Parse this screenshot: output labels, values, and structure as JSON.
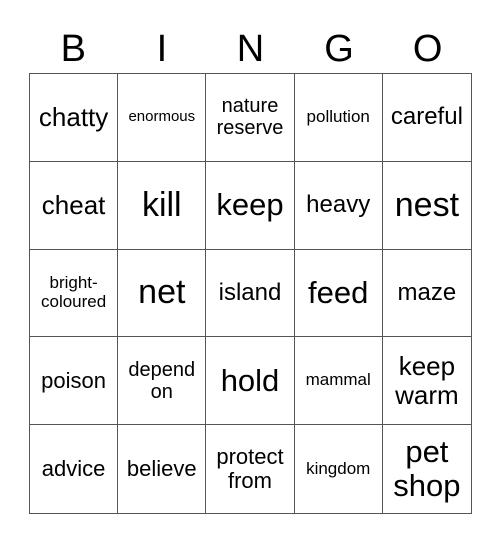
{
  "header": [
    "B",
    "I",
    "N",
    "G",
    "O"
  ],
  "cells": [
    {
      "text": "chatty",
      "size": "s26"
    },
    {
      "text": "enormous",
      "size": "s14"
    },
    {
      "text": "nature reserve",
      "size": "s20"
    },
    {
      "text": "pollution",
      "size": "s17"
    },
    {
      "text": "careful",
      "size": "s24"
    },
    {
      "text": "cheat",
      "size": "s26"
    },
    {
      "text": "kill",
      "size": "s34"
    },
    {
      "text": "keep",
      "size": "s30"
    },
    {
      "text": "heavy",
      "size": "s24"
    },
    {
      "text": "nest",
      "size": "s34"
    },
    {
      "text": "bright-coloured",
      "size": "s17"
    },
    {
      "text": "net",
      "size": "s34"
    },
    {
      "text": "island",
      "size": "s24"
    },
    {
      "text": "feed",
      "size": "s30"
    },
    {
      "text": "maze",
      "size": "s24"
    },
    {
      "text": "poison",
      "size": "s22"
    },
    {
      "text": "depend on",
      "size": "s20"
    },
    {
      "text": "hold",
      "size": "s30"
    },
    {
      "text": "mammal",
      "size": "s17"
    },
    {
      "text": "keep warm",
      "size": "s26"
    },
    {
      "text": "advice",
      "size": "s22"
    },
    {
      "text": "believe",
      "size": "s22"
    },
    {
      "text": "protect from",
      "size": "s22"
    },
    {
      "text": "kingdom",
      "size": "s17"
    },
    {
      "text": "pet shop",
      "size": "s30"
    }
  ]
}
